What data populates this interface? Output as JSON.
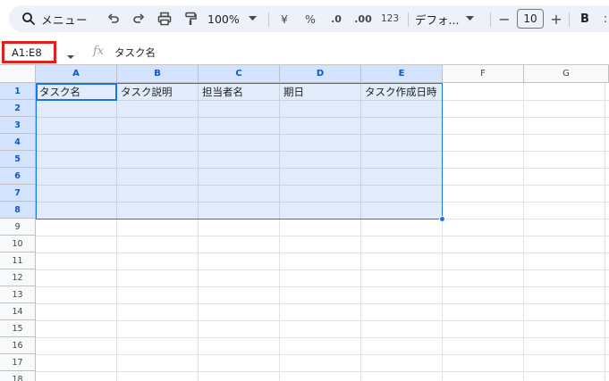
{
  "toolbar": {
    "menu_label": "メニュー",
    "zoom_label": "100%",
    "currency_label": "¥",
    "percent_label": "%",
    "decrease_decimal_label": ".0",
    "increase_decimal_label": ".00",
    "number_format_label": "123",
    "font_label": "デフォ...",
    "font_size": "10",
    "minus_label": "−",
    "plus_label": "+",
    "bold_label": "B",
    "more_label": ":",
    "icons": [
      "search-icon",
      "undo-icon",
      "redo-icon",
      "print-icon",
      "paint-format-icon",
      "chevron-down-icon"
    ]
  },
  "formula_bar": {
    "name_box": "A1:E8",
    "fx_label": "fx",
    "content": "タスク名"
  },
  "grid": {
    "columns": [
      "A",
      "B",
      "C",
      "D",
      "E",
      "F",
      "G"
    ],
    "rows": [
      "1",
      "2",
      "3",
      "4",
      "5",
      "6",
      "7",
      "8",
      "9",
      "10",
      "11",
      "12",
      "13",
      "14",
      "15",
      "16",
      "17",
      "18"
    ],
    "header_row": [
      "タスク名",
      "タスク説明",
      "担当者名",
      "期日",
      "タスク作成日時"
    ],
    "selection": "A1:E8",
    "colors": {
      "selection_border": "#1a73e8",
      "selected_header_bg": "#d3e3fd",
      "name_box_highlight": "#e0201c"
    }
  }
}
